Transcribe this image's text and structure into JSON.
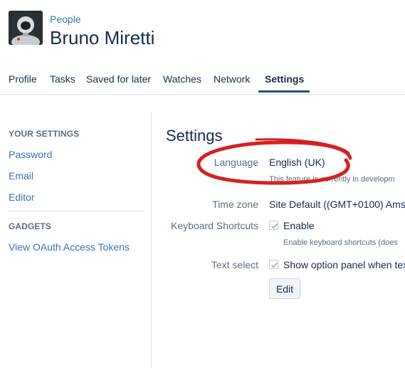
{
  "header": {
    "breadcrumb": "People",
    "title": "Bruno Miretti"
  },
  "tabs": [
    {
      "label": "Profile",
      "active": false
    },
    {
      "label": "Tasks",
      "active": false
    },
    {
      "label": "Saved for later",
      "active": false
    },
    {
      "label": "Watches",
      "active": false
    },
    {
      "label": "Network",
      "active": false
    },
    {
      "label": "Settings",
      "active": true
    }
  ],
  "sidebar": {
    "sections": [
      {
        "heading": "YOUR SETTINGS",
        "items": [
          "Password",
          "Email",
          "Editor"
        ]
      },
      {
        "heading": "GADGETS",
        "items": [
          "View OAuth Access Tokens"
        ]
      }
    ]
  },
  "main": {
    "title": "Settings",
    "language": {
      "label": "Language",
      "value": "English (UK)",
      "hint": "This feature is currently in developm"
    },
    "timezone": {
      "label": "Time zone",
      "value": "Site Default ((GMT+0100) Amst"
    },
    "keyboard": {
      "label": "Keyboard Shortcuts",
      "checkbox_label": "Enable",
      "checked": true,
      "hint": "Enable keyboard shortcuts (does"
    },
    "text_select": {
      "label": "Text select",
      "checkbox_label": "Show option panel when tex",
      "checked": true
    },
    "edit_button": "Edit"
  },
  "colors": {
    "link": "#3b73af",
    "active_tab_underline": "#205081",
    "annotation_red": "#d62020"
  }
}
